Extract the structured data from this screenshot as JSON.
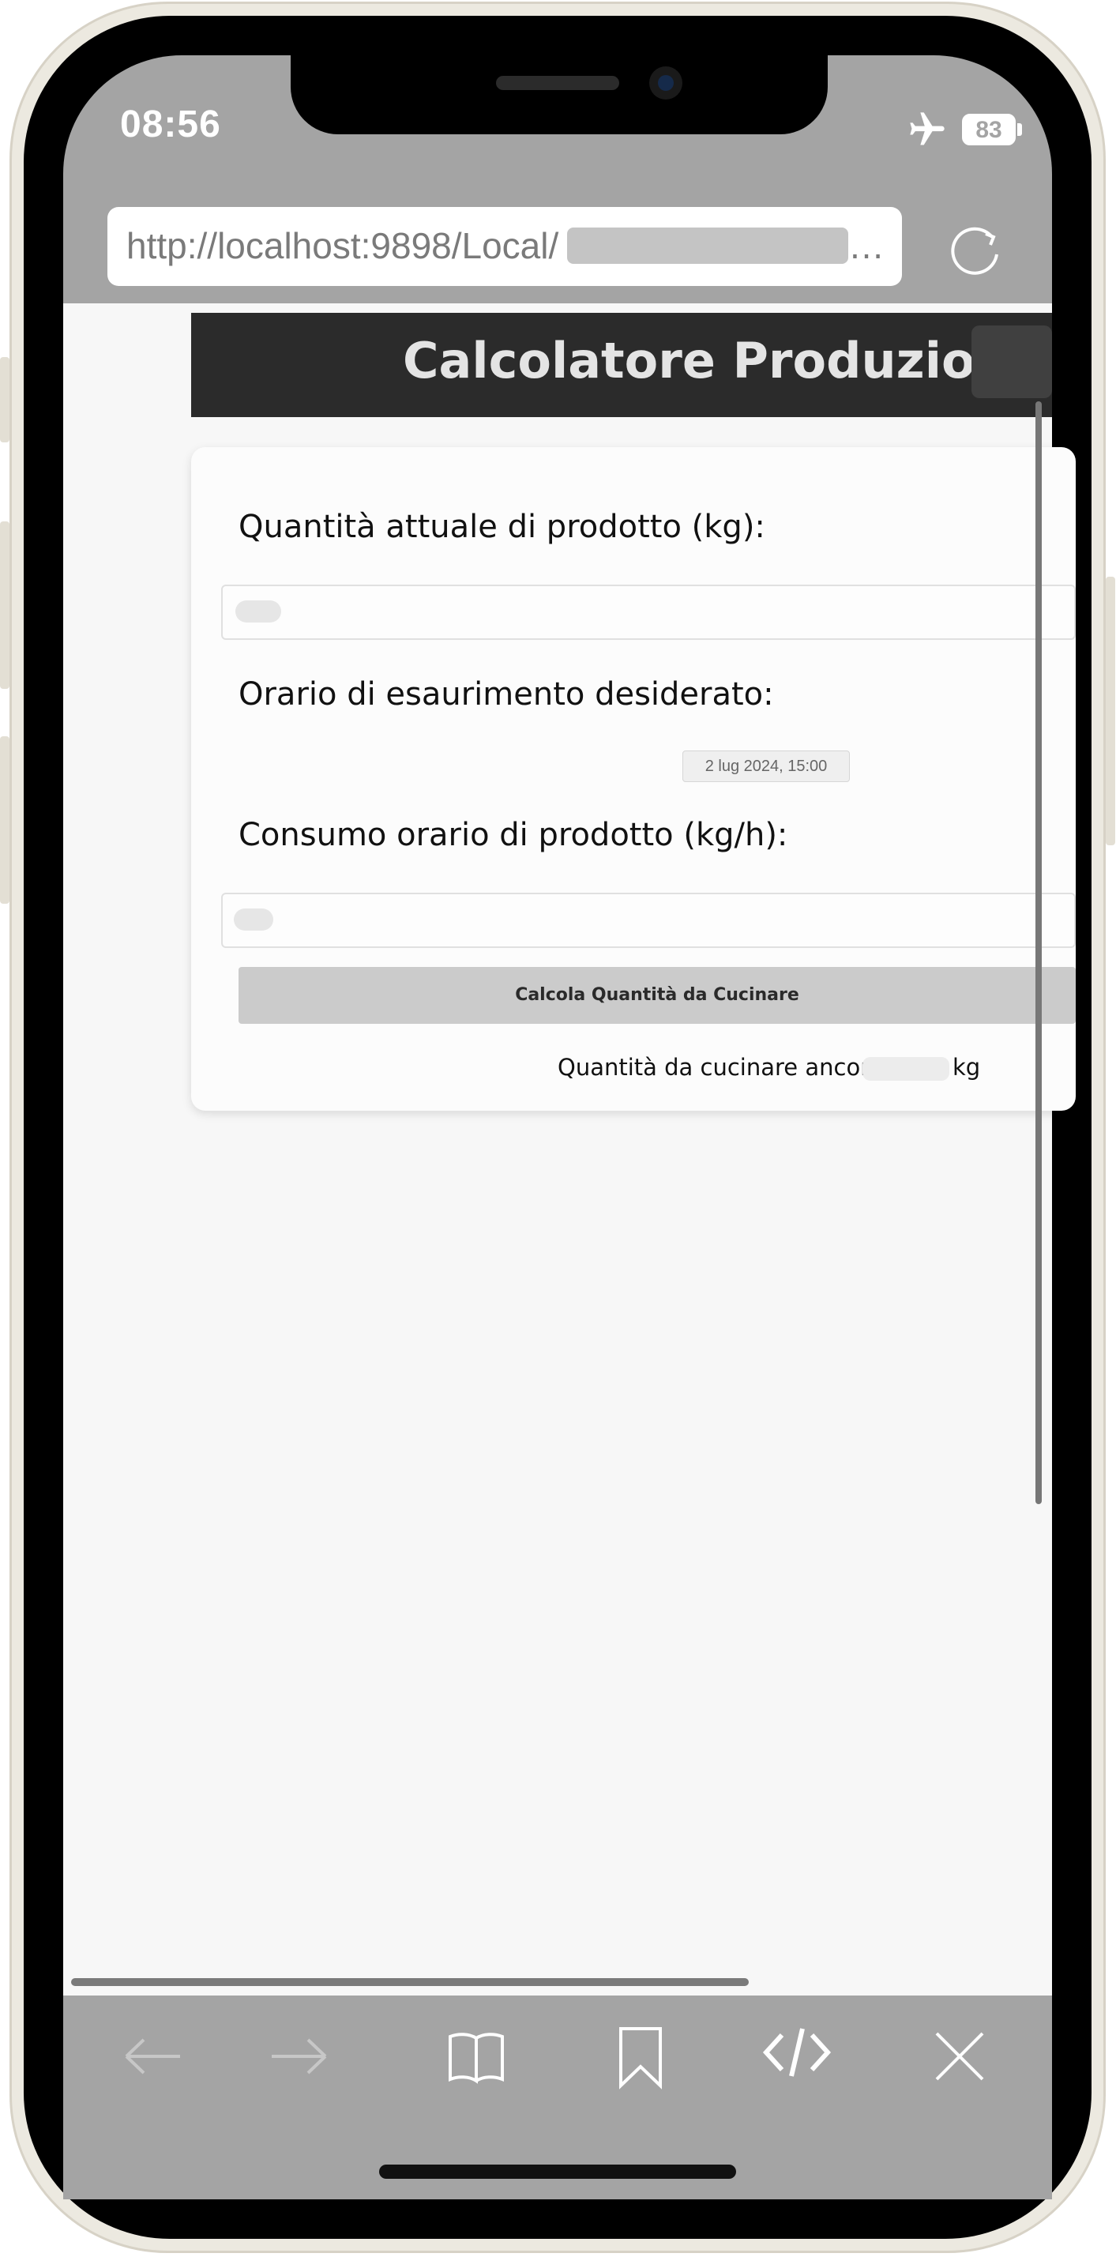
{
  "status_bar": {
    "time": "08:56",
    "battery": "83",
    "airplane_icon": "airplane-icon"
  },
  "browser": {
    "url": "http://localhost:9898/Local/",
    "url_ellipsis": "…",
    "reload_icon": "reload-icon"
  },
  "app": {
    "title": "Calcolatore Produzione",
    "form": {
      "quantity_label": "Quantità attuale di prodotto (kg):",
      "time_label": "Orario di esaurimento desiderato:",
      "time_value": "2 lug 2024, 15:00",
      "consumption_label": "Consumo orario di prodotto (kg/h):",
      "calc_button": "Calcola Quantità da Cucinare",
      "result_label": "Quantità da cucinare ancora:",
      "result_unit": "kg"
    }
  },
  "toolbar": {
    "icons": [
      "back-arrow-icon",
      "forward-arrow-icon",
      "book-icon",
      "bookmark-icon",
      "code-icon",
      "close-icon"
    ]
  },
  "colors": {
    "header_bg": "#2b2b2b",
    "chrome_gray": "#a4a4a4",
    "page_bg": "#f7f7f7"
  }
}
